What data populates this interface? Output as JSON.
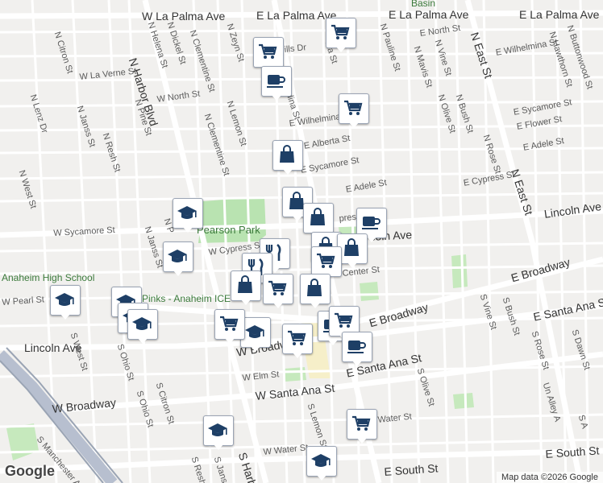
{
  "map": {
    "attribution": "Map data ©2026 Google",
    "logo": "Google",
    "park_label": "Pearson Park",
    "poi_labels": {
      "school": "Anaheim High School",
      "pinks": "Pinks - Anaheim ICE",
      "basin": "Basin"
    },
    "street_labels": {
      "w_la_palma": "W La Palma Ave",
      "e_la_palma": "E La Palma Ave",
      "e_la_palma2": "E La Palma Ave",
      "n_harbor": "N Harbor Blvd",
      "n_east": "N East St",
      "n_east2": "N East St",
      "lincoln_e": "Lincoln Ave",
      "lincoln_w": "Lincoln Ave",
      "lincoln_c": "Lincoln Ave",
      "e_broadway": "E Broadway",
      "e_broadway2": "E Broadway",
      "w_broadway": "W Broadway",
      "w_broadway2": "W Broadway",
      "e_santa_ana": "E Santa Ana St",
      "e_santa_ana2": "E Santa Ana St",
      "w_santa_ana": "W Santa Ana St",
      "e_south": "E South St",
      "e_south2": "E South St",
      "s_harbor": "S Harbor",
      "w_sycamore": "W Sycamore St",
      "e_sycamore": "E Sycamore St",
      "e_sycamore2": "E Sycamore St",
      "w_cypress": "W Cypress St",
      "e_cypress": "E Cypress St",
      "e_adele": "E Adele St",
      "e_adele2": "E Adele St",
      "e_alberta": "E Alberta St",
      "e_wilhelmina": "E Wilhelmina",
      "e_wilhelmina2": "E Wilhelmina St",
      "e_north": "E North St",
      "w_north": "W North St",
      "w_la_verne": "W La Verne St",
      "e_flower": "E Flower St",
      "w_pearl": "W Pearl St",
      "w_elm": "W Elm St",
      "water_st": "Water St",
      "w_water": "W Water St",
      "center_st": "Center St",
      "n_citron": "N Citron St",
      "n_lenz": "N Lenz Dr",
      "n_west": "N West St",
      "n_resh": "N Resh St",
      "n_janss": "N Janss St",
      "n_janss2": "N Janss St",
      "n_pine": "N Pine St",
      "n_helena": "N Helena St",
      "n_dickel": "N Dickel St",
      "n_clementine": "N Clementine St",
      "n_clementine2": "N Clementine St",
      "n_zeyn": "N Zeyn St",
      "n_lemon": "N Lemon St",
      "n_pauline": "N Pauline St",
      "n_vine": "N Vine St",
      "n_mavis": "N Mavis St",
      "n_olive": "N Olive St",
      "n_bush": "N Bush St",
      "n_rose": "N Rose St",
      "n_hawthorn": "N Hawthorn St",
      "n_buttonwood": "N Buttonwood St",
      "s_west": "S West St",
      "s_ohio": "S Ohio St",
      "s_ohio2": "S Ohio St",
      "s_citron": "S Citron St",
      "s_lemon": "S Lemon St",
      "s_olive": "S Olive St",
      "s_vine": "S Vine St",
      "s_bush": "S Bush St",
      "s_rose": "S Rose St",
      "s_dawn": "S Dawn St",
      "s_manchester": "S Manchester Ave",
      "s_janss": "S Janss St",
      "s_resh": "S Resh St",
      "un_alley": "Un Alley A",
      "s_a": "S A",
      "hills_dr": "ills Dr",
      "n_ina": "ina St",
      "n_adina": "adina St",
      "n_p": "N P",
      "press": "press",
      "coln_ave": "coln Ave"
    },
    "pins": [
      {
        "icon": "cart"
      },
      {
        "icon": "cart"
      },
      {
        "icon": "coffee"
      },
      {
        "icon": "cart"
      },
      {
        "icon": "bag"
      },
      {
        "icon": "bag"
      },
      {
        "icon": "bag"
      },
      {
        "icon": "coffee"
      },
      {
        "icon": "grad"
      },
      {
        "icon": "grad"
      },
      {
        "icon": "fork"
      },
      {
        "icon": "bag"
      },
      {
        "icon": "fork"
      },
      {
        "icon": "bag"
      },
      {
        "icon": "cart"
      },
      {
        "icon": "bag"
      },
      {
        "icon": "bag"
      },
      {
        "icon": "grad"
      },
      {
        "icon": "grad"
      },
      {
        "icon": "grad"
      },
      {
        "icon": "grad"
      },
      {
        "icon": "cart"
      },
      {
        "icon": "grad"
      },
      {
        "icon": "cart"
      },
      {
        "icon": "coffee"
      },
      {
        "icon": "cart"
      },
      {
        "icon": "coffee"
      },
      {
        "icon": "grad"
      },
      {
        "icon": "cart"
      },
      {
        "icon": "grad"
      },
      {
        "icon": "cart"
      }
    ]
  }
}
